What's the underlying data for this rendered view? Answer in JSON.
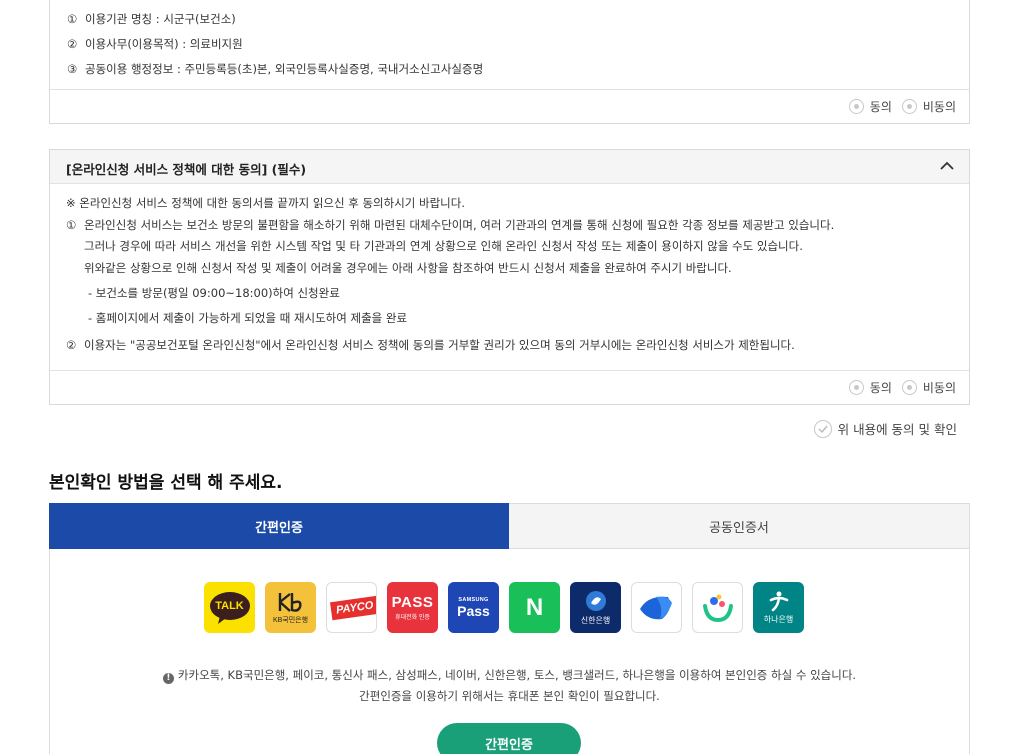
{
  "box1": {
    "items": [
      {
        "num": "①",
        "text": "이용기관 명칭 : 시군구(보건소)"
      },
      {
        "num": "②",
        "text": "이용사무(이용목적) : 의료비지원"
      },
      {
        "num": "③",
        "text": "공동이용 행정정보 : 주민등록등(초)본, 외국인등록사실증명, 국내거소신고사실증명"
      }
    ],
    "agree_label": "동의",
    "disagree_label": "비동의"
  },
  "box2": {
    "title": "[온라인신청 서비스 정책에 대한 동의] (필수)",
    "notice": "※ 온라인신청 서비스 정책에 대한 동의서를 끝까지 읽으신 후 동의하시기 바랍니다.",
    "item1_num": "①",
    "item1_line1": "온라인신청 서비스는 보건소 방문의 불편함을 해소하기 위해 마련된 대체수단이며, 여러 기관과의 연계를 통해 신청에 필요한 각종 정보를 제공받고 있습니다.",
    "item1_line2": "그러나 경우에 따라 서비스 개선을 위한 시스템 작업 및 타 기관과의 연계 상황으로 인해 온라인 신청서 작성 또는 제출이 용이하지 않을 수도 있습니다.",
    "item1_line3": "위와같은 상황으로 인해 신청서 작성 및 제출이 어려울 경우에는 아래 사항을 참조하여 반드시 신청서 제출을 완료하여 주시기 바랍니다.",
    "dash1": "-  보건소를 방문(평일 09:00~18:00)하여 신청완료",
    "dash2": "-  홈페이지에서 제출이 가능하게 되었을 때 재시도하여 제출을 완료",
    "item2_num": "②",
    "item2_text": "이용자는 \"공공보건포털 온라인신청\"에서 온라인신청 서비스 정책에 동의를 거부할 권리가 있으며 동의 거부시에는 온라인신청 서비스가 제한됩니다.",
    "agree_label": "동의",
    "disagree_label": "비동의"
  },
  "confirm_label": "위 내용에 동의 및 확인",
  "section_title": "본인확인 방법을 선택 해 주세요.",
  "tabs": [
    {
      "label": "간편인증"
    },
    {
      "label": "공동인증서"
    }
  ],
  "providers": {
    "kakao": "TALK",
    "kb_sub": "KB국민은행",
    "payco": "PAYCO",
    "pass": "PASS",
    "pass_sub": "휴대전화 인증",
    "samsung_top": "SAMSUNG",
    "samsung_main": "Pass",
    "naver": "N",
    "shinhan_sub": "신한은행",
    "hana_sub": "하나은행"
  },
  "note1": "카카오톡, KB국민은행, 페이코, 통신사 패스, 삼성패스, 네이버, 신한은행, 토스, 뱅크샐러드, 하나은행을 이용하여 본인인증 하실 수 있습니다.",
  "note2": "간편인증을 이용하기 위해서는 휴대폰 본인 확인이 필요합니다.",
  "auth_button": "간편인증",
  "colors": {
    "primary_tab": "#1c4aa9",
    "auth_button": "#1aa079"
  }
}
